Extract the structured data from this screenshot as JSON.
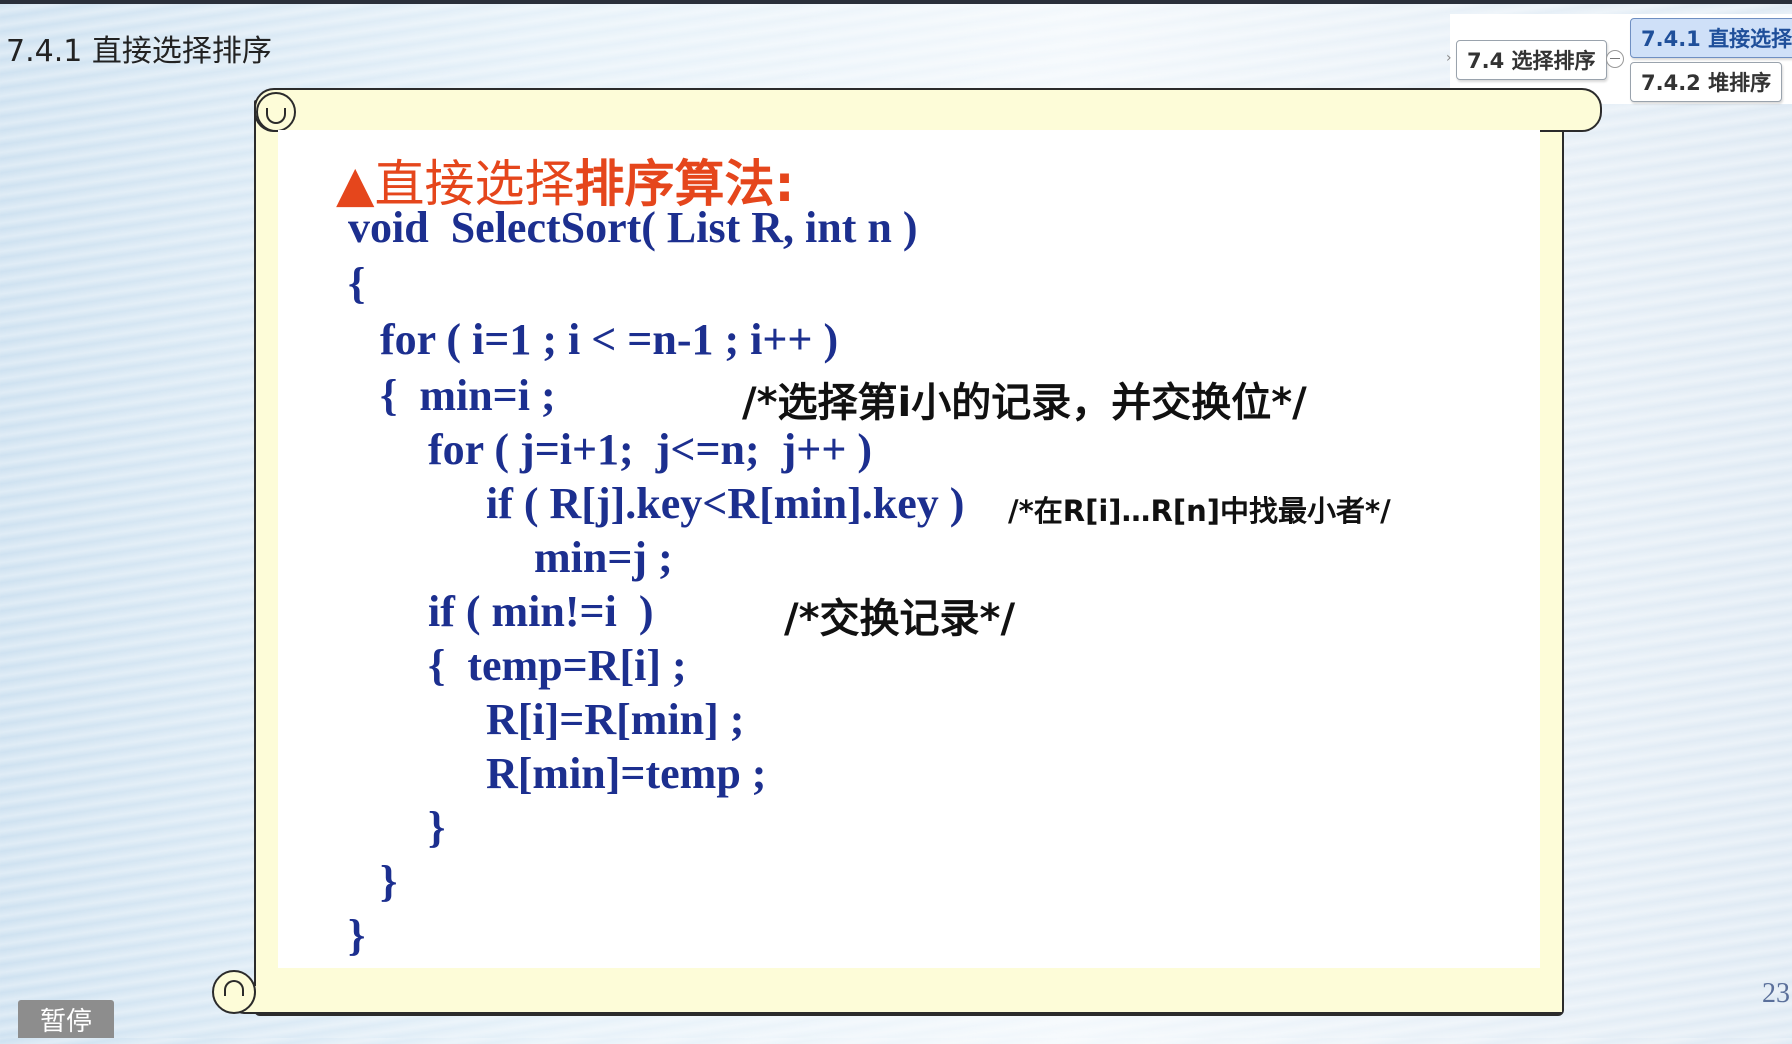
{
  "slide": {
    "title": "7.4.1 直接选择排序",
    "page_number": "23"
  },
  "outline_nav": {
    "parent": "7.4 选择排序",
    "items": [
      "7.4.1 直接选择",
      "7.4.2 堆排序"
    ]
  },
  "content": {
    "heading_prefix": "▲直接选择",
    "heading_bold": "排序算法:",
    "code_lines": [
      "void  SelectSort( List R, int n )",
      "{",
      "for ( i=1 ; i < =n-1 ; i++ )",
      "{  min=i ;",
      "for ( j=i+1;  j<=n;  j++ )",
      "if ( R[j].key<R[min].key )",
      "min=j ;",
      "if ( min!=i  )",
      "{  temp=R[i] ;",
      "R[i]=R[min] ;",
      "R[min]=temp ;",
      "}",
      "}",
      "}"
    ],
    "comments": {
      "select_ith": "/*选择第i小的记录，并交换位*/",
      "find_min": "/*在R[i]…R[n]中找最小者*/",
      "swap": "/*交换记录*/"
    }
  },
  "controls": {
    "pause_label": "暂停"
  },
  "colors": {
    "code": "#1c2f8f",
    "heading": "#e5461c",
    "scroll_fill": "#fdfcd8"
  }
}
